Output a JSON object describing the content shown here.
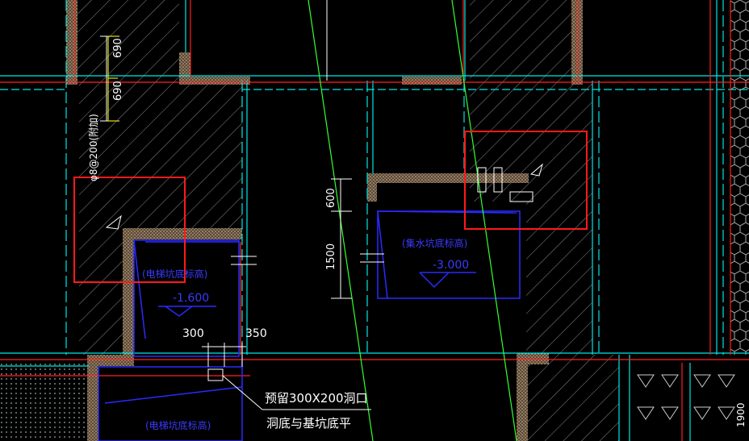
{
  "drawing": {
    "labels": {
      "dim_690_a": "690",
      "dim_690_b": "690",
      "rebar_note": "φ8@200(附加)",
      "dim_600": "600",
      "dim_1500": "1500",
      "dim_300": "300",
      "dim_350": "350",
      "pit_elevation_label_left": "(电梯坑底标高)",
      "pit_elevation_value_left": "-1.600",
      "pit_elevation_label_right": "(集水坑底标高)",
      "pit_elevation_value_right": "-3.000",
      "pit_elevation_label_bottom": "(电梯坑底标高)",
      "note_opening": "预留300X200洞口",
      "note_opening_level": "洞底与基坑底平",
      "dim_1900": "1900"
    },
    "colors": {
      "background": "#000000",
      "cyan": "#00e5e5",
      "red": "#ff2020",
      "white": "#ffffff",
      "green": "#33ff33",
      "blue": "#2a2aff",
      "yellow": "#e6e600",
      "hatch": "#c9a27a",
      "highlight_box": "#ff1a1a"
    }
  }
}
